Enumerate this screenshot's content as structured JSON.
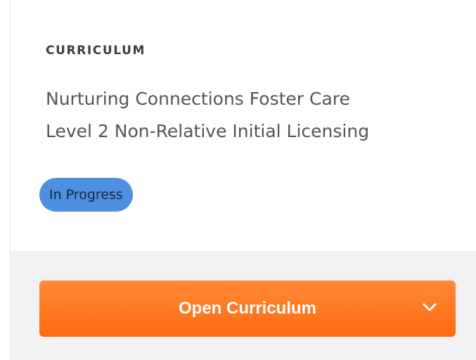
{
  "card": {
    "eyebrow": "CURRICULUM",
    "title_line1": "Nurturing Connections Foster Care",
    "title_line2": "Level 2 Non-Relative Initial Licensing",
    "status_badge": "In Progress",
    "action_button_label": "Open Curriculum",
    "action_button_icon": "chevron-down-icon"
  },
  "colors": {
    "badge_background": "#4e8fe0",
    "button_gradient_top": "#ff8a3a",
    "button_gradient_bottom": "#ff6a0e",
    "footer_background": "#f2f2f2"
  }
}
